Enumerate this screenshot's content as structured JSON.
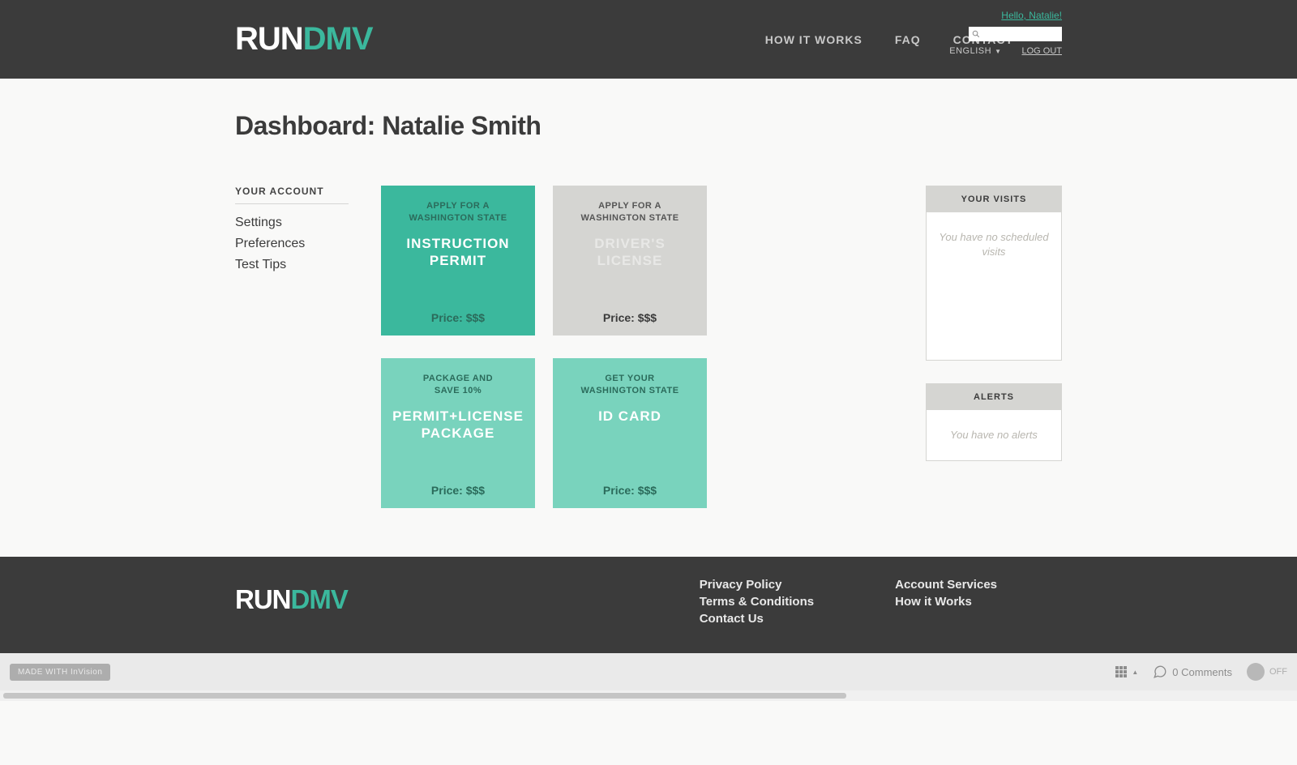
{
  "header": {
    "logo_run": "RUN",
    "logo_dmv": "DMV",
    "nav": {
      "how_it_works": "HOW IT WORKS",
      "faq": "FAQ",
      "contact": "CONTACT"
    },
    "hello": "Hello, Natalie!",
    "language": "ENGLISH",
    "logout": "LOG OUT"
  },
  "page_title": "Dashboard: Natalie Smith",
  "sidebar": {
    "heading": "YOUR ACCOUNT",
    "links": {
      "settings": "Settings",
      "preferences": "Preferences",
      "test_tips": "Test Tips"
    }
  },
  "cards": {
    "permit": {
      "label1": "APPLY FOR A",
      "label2": "WASHINGTON STATE",
      "title": "INSTRUCTION PERMIT",
      "price": "Price: $$$"
    },
    "license": {
      "label1": "APPLY FOR A",
      "label2": "WASHINGTON STATE",
      "title": "DRIVER'S LICENSE",
      "price": "Price: $$$"
    },
    "package": {
      "label1": "PACKAGE AND",
      "label2": "SAVE 10%",
      "title": "PERMIT+LICENSE PACKAGE",
      "price": "Price: $$$"
    },
    "idcard": {
      "label1": "GET YOUR",
      "label2": "WASHINGTON STATE",
      "title": "ID CARD",
      "price": "Price: $$$"
    }
  },
  "panels": {
    "visits": {
      "heading": "YOUR VISITS",
      "empty": "You have no scheduled visits"
    },
    "alerts": {
      "heading": "ALERTS",
      "empty": "You have no alerts"
    }
  },
  "footer": {
    "logo_run": "RUN",
    "logo_dmv": "DMV",
    "col1": {
      "privacy": "Privacy Policy",
      "terms": "Terms & Conditions",
      "contact": "Contact Us"
    },
    "col2": {
      "account": "Account Services",
      "how": "How it Works"
    }
  },
  "invision": {
    "made_with": "MADE WITH InVision",
    "comments": "0 Comments",
    "toggle": "OFF"
  }
}
